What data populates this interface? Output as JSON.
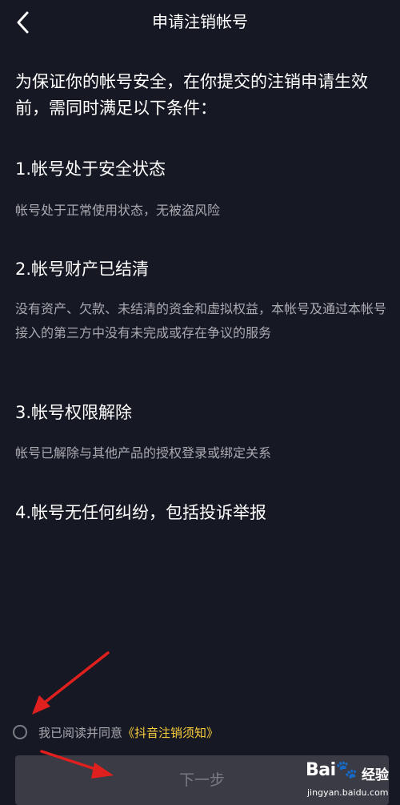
{
  "header": {
    "title": "申请注销帐号"
  },
  "intro": "为保证你的帐号安全，在你提交的注销申请生效前，需同时满足以下条件：",
  "conditions": [
    {
      "title": "1.帐号处于安全状态",
      "desc": "帐号处于正常使用状态，无被盗风险"
    },
    {
      "title": "2.帐号财产已结清",
      "desc": "没有资产、欠款、未结清的资金和虚拟权益，本帐号及通过本帐号接入的第三方中没有未完成或存在争议的服务"
    },
    {
      "title": "3.帐号权限解除",
      "desc": "帐号已解除与其他产品的授权登录或绑定关系"
    },
    {
      "title": "4.帐号无任何纠纷，包括投诉举报",
      "desc": ""
    }
  ],
  "agreement": {
    "text": "我已阅读并同意",
    "link": "《抖音注销须知》"
  },
  "next_button": "下一步",
  "watermark": {
    "logo": "Bai🐾",
    "text": "经验",
    "url": "jingyan.baidu.com"
  },
  "colors": {
    "background": "#161823",
    "accent": "#facd3c",
    "button_bg": "#3a3b44",
    "annotation_arrow": "#e0201e"
  }
}
